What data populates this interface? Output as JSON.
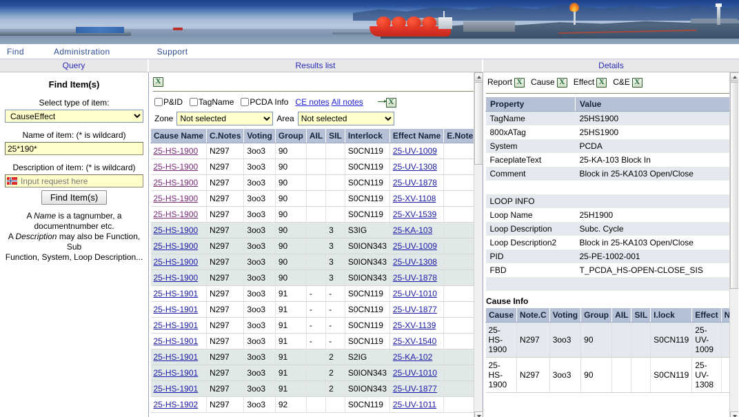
{
  "banner": {
    "alt": "lng-plant-coastal-photo"
  },
  "topnav": {
    "items": [
      {
        "label": "Find",
        "name": "nav-find"
      },
      {
        "label": "Administration",
        "name": "nav-administration"
      },
      {
        "label": "Support",
        "name": "nav-support"
      }
    ]
  },
  "panels": {
    "query_title": "Query",
    "results_title": "Results list",
    "details_title": "Details"
  },
  "query": {
    "title": "Find Item(s)",
    "type_label": "Select type of item:",
    "type_value": "CauseEffect",
    "type_options": [
      "CauseEffect"
    ],
    "name_label": "Name of item: (* is wildcard)",
    "name_value": "25*190*",
    "desc_label": "Description of item: (* is wildcard)",
    "desc_value": "",
    "desc_placeholder": "Input request here",
    "button_label": "Find Item(s)",
    "help_line1_a": "A ",
    "help_line1_i": "Name",
    "help_line1_b": " is a tagnumber, a",
    "help_line2": "documentnumber etc.",
    "help_line3_a": "A ",
    "help_line3_i": "Description",
    "help_line3_b": " may also be Function, Sub",
    "help_line4": "Function, System, Loop Description..."
  },
  "results": {
    "export_icon": "excel-icon",
    "checkboxes": [
      {
        "label": "P&ID",
        "checked": false,
        "name": "checkbox-pid"
      },
      {
        "label": "TagName",
        "checked": false,
        "name": "checkbox-tagname"
      },
      {
        "label": "PCDA Info",
        "checked": false,
        "name": "checkbox-pcda-info"
      }
    ],
    "links": [
      {
        "label": "CE notes",
        "name": "ce-notes-link"
      },
      {
        "label": "All notes",
        "name": "all-notes-link"
      }
    ],
    "zone_label": "Zone",
    "zone_value": "Not selected",
    "area_label": "Area",
    "area_value": "Not selected",
    "select_options": [
      "Not selected"
    ],
    "columns": [
      "Cause Name",
      "C.Notes",
      "Voting",
      "Group",
      "AIL",
      "SIL",
      "Interlock",
      "Effect Name",
      "E.Notes"
    ],
    "rows": [
      {
        "cause": "25-HS-1900",
        "cnotes": "N297",
        "voting": "3oo3",
        "group": "90",
        "ail": "",
        "sil": "",
        "interlock": "S0CN119",
        "effect": "25-UV-1009",
        "enotes": "",
        "visited": true,
        "alt": false
      },
      {
        "cause": "25-HS-1900",
        "cnotes": "N297",
        "voting": "3oo3",
        "group": "90",
        "ail": "",
        "sil": "",
        "interlock": "S0CN119",
        "effect": "25-UV-1308",
        "enotes": "",
        "visited": true,
        "alt": false
      },
      {
        "cause": "25-HS-1900",
        "cnotes": "N297",
        "voting": "3oo3",
        "group": "90",
        "ail": "",
        "sil": "",
        "interlock": "S0CN119",
        "effect": "25-UV-1878",
        "enotes": "",
        "visited": true,
        "alt": false
      },
      {
        "cause": "25-HS-1900",
        "cnotes": "N297",
        "voting": "3oo3",
        "group": "90",
        "ail": "",
        "sil": "",
        "interlock": "S0CN119",
        "effect": "25-XV-1108",
        "enotes": "",
        "visited": true,
        "alt": false
      },
      {
        "cause": "25-HS-1900",
        "cnotes": "N297",
        "voting": "3oo3",
        "group": "90",
        "ail": "",
        "sil": "",
        "interlock": "S0CN119",
        "effect": "25-XV-1539",
        "enotes": "",
        "visited": true,
        "alt": false
      },
      {
        "cause": "25-HS-1900 ",
        "cnotes": "N297",
        "voting": "3oo3",
        "group": "90",
        "ail": "",
        "sil": "3",
        "interlock": "S3IG",
        "effect": "25-KA-103",
        "enotes": "",
        "visited": false,
        "alt": true
      },
      {
        "cause": "25-HS-1900 ",
        "cnotes": "N297",
        "voting": "3oo3",
        "group": "90",
        "ail": "",
        "sil": "3",
        "interlock": "S0ION343",
        "effect": "25-UV-1009",
        "enotes": "",
        "visited": false,
        "alt": true
      },
      {
        "cause": "25-HS-1900 ",
        "cnotes": "N297",
        "voting": "3oo3",
        "group": "90",
        "ail": "",
        "sil": "3",
        "interlock": "S0ION343",
        "effect": "25-UV-1308",
        "enotes": "",
        "visited": false,
        "alt": true
      },
      {
        "cause": "25-HS-1900 ",
        "cnotes": "N297",
        "voting": "3oo3",
        "group": "90",
        "ail": "",
        "sil": "3",
        "interlock": "S0ION343",
        "effect": "25-UV-1878",
        "enotes": "",
        "visited": false,
        "alt": true
      },
      {
        "cause": "25-HS-1901",
        "cnotes": "N297",
        "voting": "3oo3",
        "group": "91",
        "ail": "-",
        "sil": "-",
        "interlock": "S0CN119",
        "effect": "25-UV-1010",
        "enotes": "",
        "visited": false,
        "alt": false
      },
      {
        "cause": "25-HS-1901",
        "cnotes": "N297",
        "voting": "3oo3",
        "group": "91",
        "ail": "-",
        "sil": "-",
        "interlock": "S0CN119",
        "effect": "25-UV-1877",
        "enotes": "",
        "visited": false,
        "alt": false
      },
      {
        "cause": "25-HS-1901",
        "cnotes": "N297",
        "voting": "3oo3",
        "group": "91",
        "ail": "-",
        "sil": "-",
        "interlock": "S0CN119",
        "effect": "25-XV-1139",
        "enotes": "",
        "visited": false,
        "alt": false
      },
      {
        "cause": "25-HS-1901",
        "cnotes": "N297",
        "voting": "3oo3",
        "group": "91",
        "ail": "-",
        "sil": "-",
        "interlock": "S0CN119",
        "effect": "25-XV-1540",
        "enotes": "",
        "visited": false,
        "alt": false
      },
      {
        "cause": "25-HS-1901 ",
        "cnotes": "N297",
        "voting": "3oo3",
        "group": "91",
        "ail": "",
        "sil": "2",
        "interlock": "S2IG",
        "effect": "25-KA-102",
        "enotes": "",
        "visited": false,
        "alt": true
      },
      {
        "cause": "25-HS-1901 ",
        "cnotes": "N297",
        "voting": "3oo3",
        "group": "91",
        "ail": "",
        "sil": "2",
        "interlock": "S0ION343",
        "effect": "25-UV-1010",
        "enotes": "",
        "visited": false,
        "alt": true
      },
      {
        "cause": "25-HS-1901 ",
        "cnotes": "N297",
        "voting": "3oo3",
        "group": "91",
        "ail": "",
        "sil": "2",
        "interlock": "S0ION343",
        "effect": "25-UV-1877",
        "enotes": "",
        "visited": false,
        "alt": true
      },
      {
        "cause": "25-HS-1902",
        "cnotes": "N297",
        "voting": "3oo3",
        "group": "92",
        "ail": "",
        "sil": "",
        "interlock": "S0CN119",
        "effect": "25-UV-1011",
        "enotes": "",
        "visited": false,
        "alt": false
      }
    ]
  },
  "details": {
    "export_buttons": [
      {
        "label": "Report",
        "name": "export-report-button"
      },
      {
        "label": "Cause",
        "name": "export-cause-button"
      },
      {
        "label": "Effect",
        "name": "export-effect-button"
      },
      {
        "label": "C&E",
        "name": "export-ce-button"
      }
    ],
    "prop_columns": [
      "Property",
      "Value"
    ],
    "properties": [
      {
        "key": "TagName",
        "value": "25HS1900"
      },
      {
        "key": "800xATag",
        "value": "25HS1900"
      },
      {
        "key": "System",
        "value": "PCDA"
      },
      {
        "key": "FaceplateText",
        "value": "25-KA-103 Block In"
      },
      {
        "key": "Comment",
        "value": "Block in 25-KA103 Open/Close"
      },
      {
        "key": "",
        "value": ""
      },
      {
        "key": "LOOP INFO",
        "value": ""
      },
      {
        "key": "Loop Name",
        "value": "25H1900"
      },
      {
        "key": "Loop Description",
        "value": "Subc. Cycle"
      },
      {
        "key": "Loop Description2",
        "value": "Block in 25-KA103 Open/Close"
      },
      {
        "key": "PID",
        "value": "25-PE-1002-001"
      },
      {
        "key": "FBD",
        "value": "T_PCDA_HS-OPEN-CLOSE_SIS"
      },
      {
        "key": "",
        "value": ""
      }
    ],
    "cause_info_title": "Cause Info",
    "cause_info_columns": [
      "Cause",
      "Note.C",
      "Voting",
      "Group",
      "AIL",
      "SIL",
      "I.lock",
      "Effect",
      "Note.E"
    ],
    "cause_info_rows": [
      {
        "cause": "25-HS-1900",
        "notec": "N297",
        "voting": "3oo3",
        "group": "90",
        "ail": "",
        "sil": "",
        "ilock": "S0CN119",
        "effect": "25-UV-1009",
        "notee": "",
        "alt": true
      },
      {
        "cause": "25-HS-1900",
        "notec": "N297",
        "voting": "3oo3",
        "group": "90",
        "ail": "",
        "sil": "",
        "ilock": "S0CN119",
        "effect": "25-UV-1308",
        "notee": "",
        "alt": false
      }
    ]
  }
}
